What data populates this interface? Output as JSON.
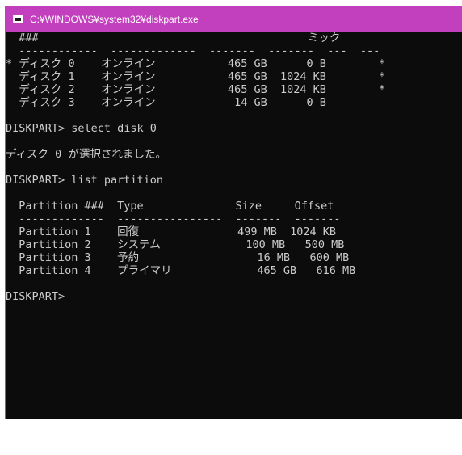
{
  "window": {
    "title": "C:¥WINDOWS¥system32¥diskpart.exe"
  },
  "console": {
    "lines": [
      "  ###                                         ミック",
      "  ------------  -------------  -------  -------  ---  ---",
      "* ディスク 0    オンライン           465 GB      0 B        *",
      "  ディスク 1    オンライン           465 GB  1024 KB        *",
      "  ディスク 2    オンライン           465 GB  1024 KB        *",
      "  ディスク 3    オンライン            14 GB      0 B",
      "",
      "DISKPART> select disk 0",
      "",
      "ディスク 0 が選択されました。",
      "",
      "DISKPART> list partition",
      "",
      "  Partition ###  Type              Size     Offset",
      "  -------------  ----------------  -------  -------",
      "  Partition 1    回復               499 MB  1024 KB",
      "  Partition 2    システム             100 MB   500 MB",
      "  Partition 3    予約                  16 MB   600 MB",
      "  Partition 4    プライマリ             465 GB   616 MB",
      "",
      "DISKPART>"
    ]
  }
}
